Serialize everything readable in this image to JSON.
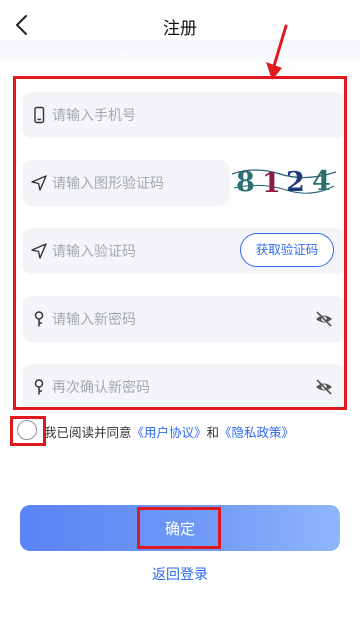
{
  "header": {
    "title": "注册",
    "back_icon": "chevron-left-icon"
  },
  "form": {
    "phone_placeholder": "请输入手机号",
    "captcha_placeholder": "请输入图形验证码",
    "captcha_text": "8124",
    "sms_placeholder": "请输入验证码",
    "get_code_label": "获取验证码",
    "new_password_placeholder": "请输入新密码",
    "confirm_password_placeholder": "再次确认新密码"
  },
  "agreement": {
    "prefix": "我已阅读并同意",
    "user_agreement": "《用户协议》",
    "and": "和",
    "privacy_policy": "《隐私政策》",
    "checked": false
  },
  "actions": {
    "confirm_label": "确定",
    "back_login_label": "返回登录"
  },
  "colors": {
    "accent": "#2e6bf0",
    "annotation": "#e0191f",
    "field_bg": "#f4f5f9"
  }
}
